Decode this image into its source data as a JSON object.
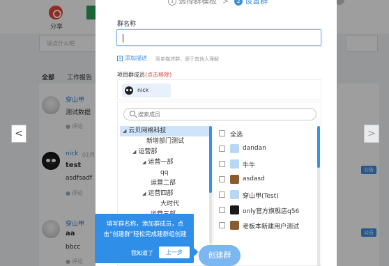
{
  "background": {
    "share_label": "分享",
    "task_label": "",
    "search_placeholder": "说点什么吧",
    "tabs": {
      "all": "全部",
      "report": "工作报告"
    },
    "posts": [
      {
        "name": "穿山甲",
        "meta": "",
        "text": "测试数据",
        "comment": "评论"
      },
      {
        "name": "nick",
        "meta": "01月",
        "text": "test",
        "subtext": "asdfsadf",
        "comment": "评论"
      },
      {
        "name": "穿山甲",
        "meta": "",
        "text": "aa",
        "subtext": "bbcc",
        "comment": "评论"
      }
    ],
    "public_badge": "公告",
    "nav_prev": "<",
    "nav_next": ">"
  },
  "modal": {
    "steps": {
      "step1_num": "1",
      "step1_label": "选择群模板",
      "sep": ">",
      "step2_num": "2",
      "step2_label": "设置群"
    },
    "group_name_label": "群名称",
    "group_name_value": "",
    "add_desc_label": "添加描述",
    "add_desc_hint": "简单描述群，便于其他人理解",
    "members_label": "项目群成员",
    "members_hint": "(点击移除)",
    "member_chip": "nick",
    "search_placeholder": "搜索成员",
    "tree": [
      {
        "label": "云贝网络科技",
        "level": 0,
        "expanded": true,
        "selected": true
      },
      {
        "label": "新增部门测试",
        "level": 1,
        "expanded": false
      },
      {
        "label": "运营部",
        "level": 1,
        "expanded": true
      },
      {
        "label": "运营一部",
        "level": 2,
        "expanded": true
      },
      {
        "label": "qq",
        "level": 3,
        "expanded": false
      },
      {
        "label": "运营二部",
        "level": 2,
        "expanded": false
      },
      {
        "label": "运营四部",
        "level": 2,
        "expanded": true
      },
      {
        "label": "大时代",
        "level": 3,
        "expanded": false
      },
      {
        "label": "运营三部",
        "level": 2,
        "expanded": false
      }
    ],
    "select_all_label": "全选",
    "members": [
      {
        "name": "dandan",
        "avatar": "light"
      },
      {
        "name": "牛牛",
        "avatar": "light"
      },
      {
        "name": "asdasd",
        "avatar": "brown"
      },
      {
        "name": "穿山甲(Test)",
        "avatar": "light"
      },
      {
        "name": "only官方旗舰店q56",
        "avatar": "dark"
      },
      {
        "name": "老板本新建用户测试",
        "avatar": "brown"
      }
    ],
    "create_button": "创建群"
  },
  "guide": {
    "text": "填写群名称，添加群成员，点击“创建群”轻松完成建群组创建",
    "ok_label": "我知道了",
    "prev_label": "上一步"
  },
  "colors": {
    "accent": "#3f8fe0",
    "guide": "#2f8ee8",
    "create": "#7ab6ef",
    "remove_hint": "#e04a3f"
  }
}
